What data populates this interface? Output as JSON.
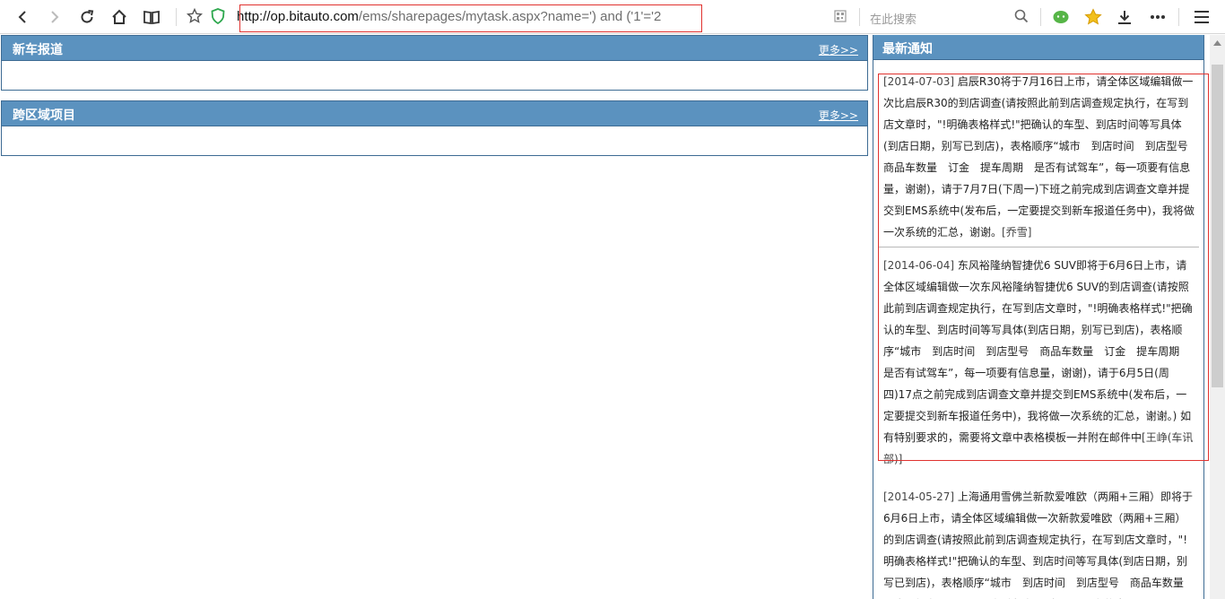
{
  "browser": {
    "url_host": "http://op.bitauto.com",
    "url_path": "/ems/sharepages/mytask.aspx?name=') and ('1'='2",
    "search_placeholder": "在此搜索"
  },
  "panels": [
    {
      "title": "新车报道",
      "more": "更多>>"
    },
    {
      "title": "跨区域项目",
      "more": "更多>>"
    }
  ],
  "notice": {
    "title": "最新通知",
    "items": [
      {
        "date": "[2014-07-03]",
        "text": " 启辰R30将于7月16日上市，请全体区域编辑做一次比启辰R30的到店调查(请按照此前到店调查规定执行，在写到店文章时，\"!明确表格样式!\"把确认的车型、到店时间等写具体(到店日期，别写已到店)，表格顺序“城市　到店时间　到店型号　商品车数量　订金　提车周期　是否有试驾车”，每一项要有信息量，谢谢)，请于7月7日(下周一)下班之前完成到店调查文章并提交到EMS系统中(发布后，一定要提交到新车报道任务中)，我将做一次系统的汇总，谢谢。",
        "author": "[乔雪]"
      },
      {
        "date": "[2014-06-04]",
        "text": " 东风裕隆纳智捷优6 SUV即将于6月6日上市，请全体区域编辑做一次东风裕隆纳智捷优6 SUV的到店调查(请按照此前到店调查规定执行，在写到店文章时，\"!明确表格样式!\"把确认的车型、到店时间等写具体(到店日期，别写已到店)，表格顺序“城市　到店时间　到店型号　商品车数量　订金　提车周期　是否有试驾车”，每一项要有信息量，谢谢)，请于6月5日(周四)17点之前完成到店调查文章并提交到EMS系统中(发布后，一定要提交到新车报道任务中)，我将做一次系统的汇总，谢谢。) 如有特别要求的，需要将文章中表格模板一并附在邮件中",
        "author": "[王峥(车讯部)]"
      },
      {
        "date": "[2014-05-27]",
        "text": " 上海通用雪佛兰新款爱唯欧（两厢+三厢）即将于6月6日上市，请全体区域编辑做一次新款爱唯欧（两厢+三厢）的到店调查(请按照此前到店调查规定执行，在写到店文章时，\"!明确表格样式!\"把确认的车型、到店时间等写具体(到店日期，别写已到店)，表格顺序“城市　到店时间　到店型号　商品车数量　订金　提车周期　是否有试驾车”，每一项要有信息量，",
        "author": ""
      }
    ]
  },
  "colors": {
    "panel_header": "#5b92bf",
    "panel_border": "#3d6b93",
    "highlight_box": "#e0322f"
  },
  "icons": [
    "back-icon",
    "forward-icon",
    "reload-icon",
    "home-icon",
    "reader-icon",
    "bookmark-star-icon",
    "shield-icon",
    "qr-icon",
    "search-icon",
    "wechat-icon",
    "favorites-star-icon",
    "download-icon",
    "more-icon",
    "menu-icon"
  ]
}
